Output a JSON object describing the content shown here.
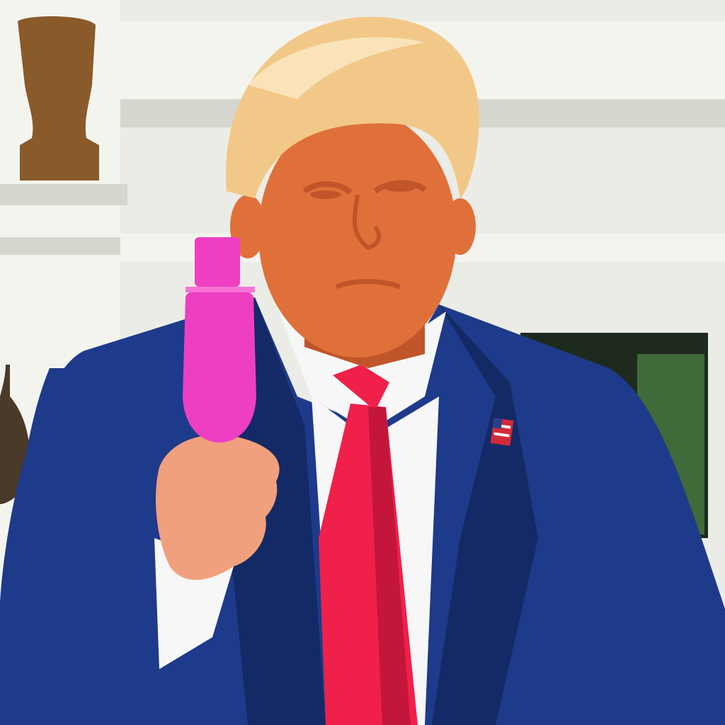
{
  "scene": {
    "colors": {
      "wall": "#ecece6",
      "wall_shadow": "#d6d6cf",
      "trim": "#f4f4ef",
      "statue": "#8a5a2b",
      "urn": "#4a3a2a",
      "window": "#1f2a1f",
      "window_green": "#3f6a3a",
      "suit": "#1e3a8a",
      "suit_dark": "#132a66",
      "shirt": "#f7f7f7",
      "tie": "#f0204a",
      "tie_dark": "#c3163a",
      "hair": "#f2c888",
      "hair_light": "#fae3b8",
      "skin": "#e0703a",
      "skin_dark": "#c0552a",
      "bottle": "#ee3fc2",
      "bottle_light": "#f772d6",
      "hand": "#f0a07c",
      "pin_blue": "#2b3f8c",
      "pin_red": "#d22b3a"
    },
    "icons": [
      "statue-icon",
      "urn-icon",
      "flag-pin-icon"
    ]
  }
}
